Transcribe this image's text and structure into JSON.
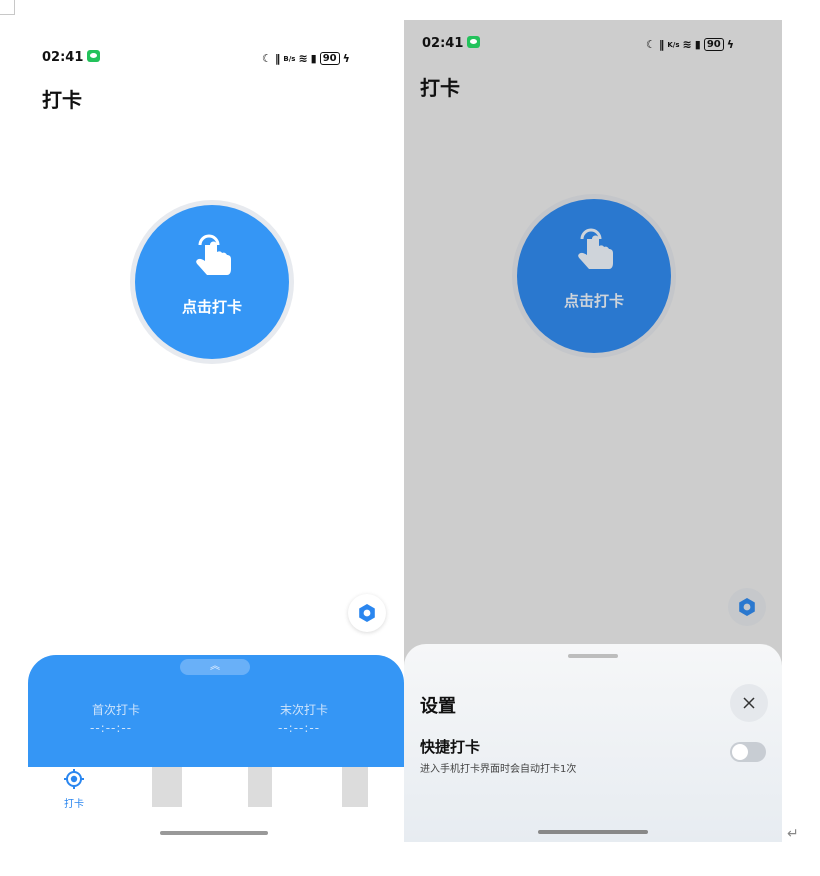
{
  "left_screen": {
    "status": {
      "time": "02:41",
      "data_speed": "B/s",
      "battery": "90"
    },
    "page_title": "打卡",
    "punch_button_label": "点击打卡",
    "records": {
      "first_label": "首次打卡",
      "first_value": "--:--:--",
      "last_label": "末次打卡",
      "last_value": "--:--:--"
    },
    "tabs": [
      {
        "label": "打卡",
        "icon": "target-icon",
        "active": true
      }
    ]
  },
  "right_screen": {
    "status": {
      "time": "02:41",
      "data_speed": "K/s",
      "battery": "90"
    },
    "page_title": "打卡",
    "punch_button_label": "点击打卡",
    "settings_sheet": {
      "title": "设置",
      "option_title": "快捷打卡",
      "option_description": "进入手机打卡界面时会自动打卡1次",
      "toggle_on": false
    }
  },
  "colors": {
    "primary_blue": "#3596f5",
    "dim_blue": "#2c7ad0",
    "overlay_gray": "#cdcdcd",
    "sheet_bg": "#f3f5f7"
  }
}
